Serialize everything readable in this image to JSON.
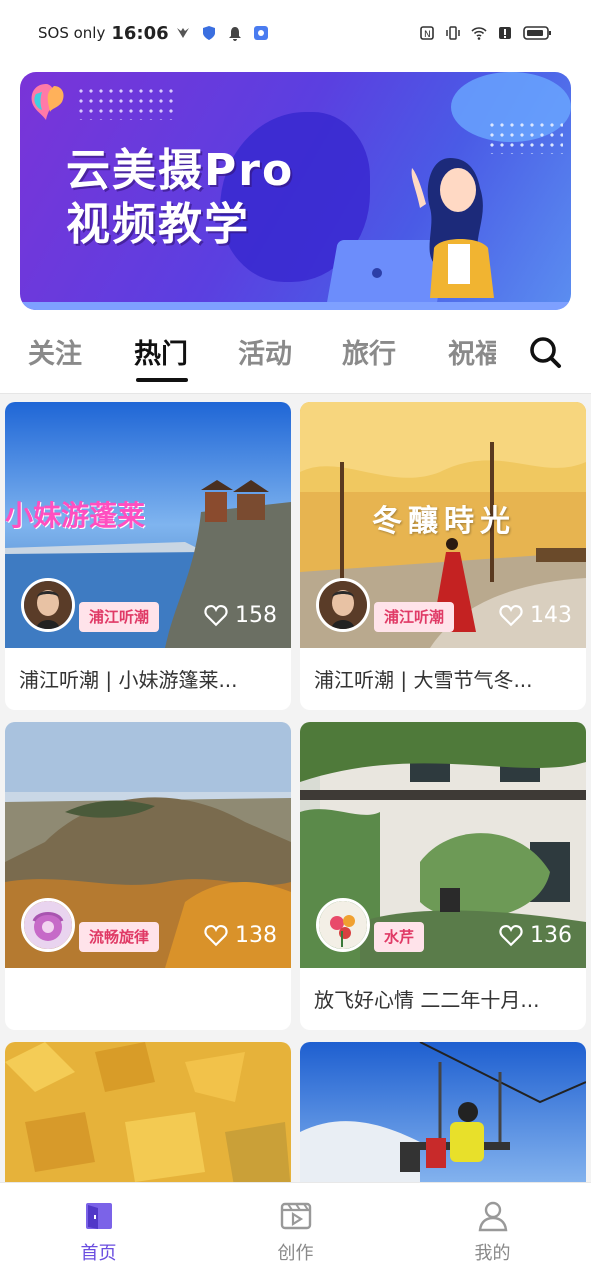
{
  "status_bar": {
    "carrier": "SOS only",
    "time": "16:06"
  },
  "banner": {
    "title_line1": "云美摄Pro",
    "title_line2": "视频教学"
  },
  "tabs": [
    {
      "label": "关注",
      "active": false
    },
    {
      "label": "热门",
      "active": true
    },
    {
      "label": "活动",
      "active": false
    },
    {
      "label": "旅行",
      "active": false
    },
    {
      "label": "祝福",
      "active": false
    }
  ],
  "cards": [
    {
      "author": "浦江听潮",
      "likes": "158",
      "title": "浦江听潮 | 小妹游篷莱...",
      "overlay": "小妹游蓬莱"
    },
    {
      "author": "浦江听潮",
      "likes": "143",
      "title": "浦江听潮 | 大雪节气冬...",
      "overlay": "冬釀時光"
    },
    {
      "author": "流畅旋律",
      "likes": "138",
      "title": ""
    },
    {
      "author": "水芹",
      "likes": "136",
      "title": "放飞好心情 二二年十月..."
    }
  ],
  "bottom_nav": [
    {
      "label": "首页",
      "icon": "home-icon",
      "active": true
    },
    {
      "label": "创作",
      "icon": "create-icon",
      "active": false
    },
    {
      "label": "我的",
      "icon": "profile-icon",
      "active": false
    }
  ],
  "colors": {
    "accent": "#6a4de0",
    "tag_bg": "#ffe3ea",
    "tag_text": "#e03a66"
  }
}
